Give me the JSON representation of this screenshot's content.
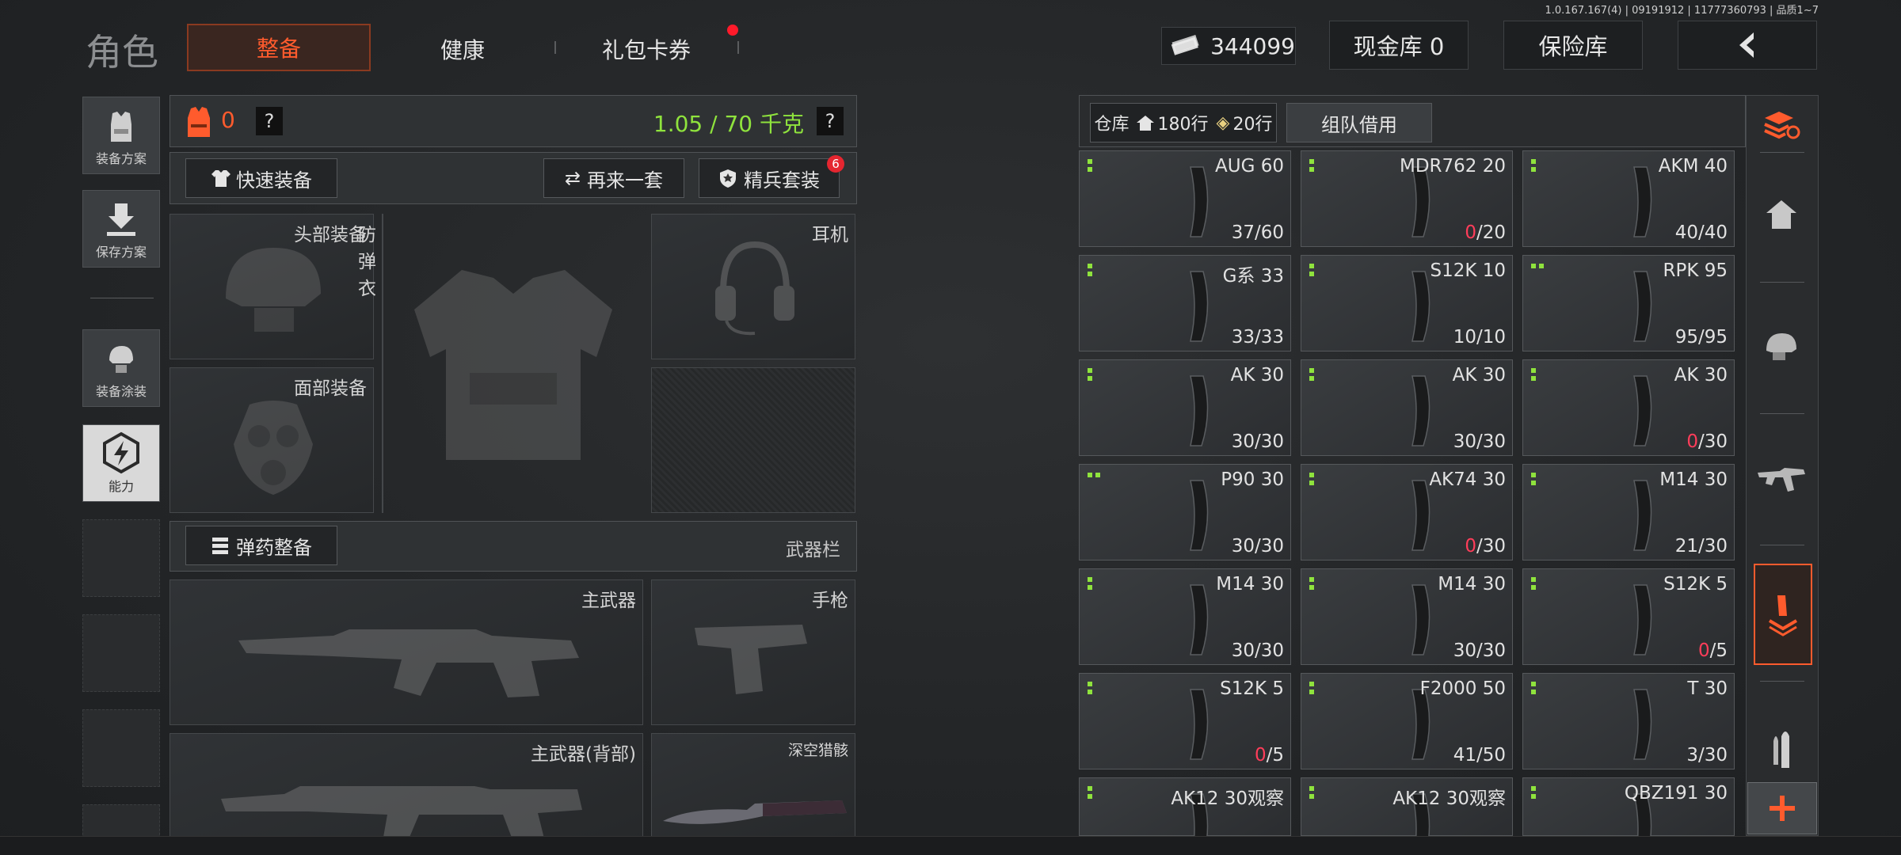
{
  "version": "1.0.167.167(4) | 09191912 | 11777360793 | 品质1~7",
  "header": {
    "title": "角色",
    "tabs": [
      {
        "label": "整备",
        "active": true
      },
      {
        "label": "健康",
        "active": false
      },
      {
        "label": "礼包卡券",
        "active": false,
        "badge_dot": true
      }
    ],
    "currency_value": "344099",
    "cash_vault": "现金库 0",
    "insurance_vault": "保险库",
    "back_icon": "chevron-left-icon"
  },
  "left_sidebar": [
    {
      "label": "装备方案",
      "icon": "vest-icon"
    },
    {
      "label": "保存方案",
      "icon": "download-icon"
    },
    {
      "label": "装备涂装",
      "icon": "helmet-paint-icon"
    },
    {
      "label": "能力",
      "icon": "ability-icon"
    }
  ],
  "loadout": {
    "armor_value": "0",
    "weight": "1.05 / 70 千克",
    "help": "?",
    "quick_equip": "快速装备",
    "another_set": "再来一套",
    "elite_set": "精兵套装",
    "elite_badge": "6",
    "slots": {
      "head": "头部装备",
      "armor": "防弹衣",
      "headset": "耳机",
      "face": "面部装备",
      "primary": "主武器",
      "pistol": "手枪",
      "primary_back": "主武器(背部)",
      "melee": "深空猎骸"
    },
    "ammo_equip": "弹药整备",
    "weapon_bar": "武器栏"
  },
  "inventory": {
    "warehouse_label": "仓库",
    "rows_home": "180行",
    "rows_extra": "20行",
    "team_borrow": "组队借用",
    "items": [
      {
        "name": "AUG 60",
        "count_cur": "37",
        "count_max": "/60",
        "empty": false
      },
      {
        "name": "MDR762 20",
        "count_cur": "0",
        "count_max": "/20",
        "empty": true
      },
      {
        "name": "AKM 40",
        "count_cur": "40",
        "count_max": "/40",
        "empty": false
      },
      {
        "name": "G系 33",
        "count_cur": "33",
        "count_max": "/33",
        "empty": false
      },
      {
        "name": "S12K 10",
        "count_cur": "10",
        "count_max": "/10",
        "empty": false
      },
      {
        "name": "RPK 95",
        "count_cur": "95",
        "count_max": "/95",
        "empty": false
      },
      {
        "name": "AK 30",
        "count_cur": "30",
        "count_max": "/30",
        "empty": false
      },
      {
        "name": "AK 30",
        "count_cur": "30",
        "count_max": "/30",
        "empty": false
      },
      {
        "name": "AK 30",
        "count_cur": "0",
        "count_max": "/30",
        "empty": true
      },
      {
        "name": "P90 30",
        "count_cur": "30",
        "count_max": "/30",
        "empty": false
      },
      {
        "name": "AK74 30",
        "count_cur": "0",
        "count_max": "/30",
        "empty": true
      },
      {
        "name": "M14 30",
        "count_cur": "21",
        "count_max": "/30",
        "empty": false
      },
      {
        "name": "M14 30",
        "count_cur": "30",
        "count_max": "/30",
        "empty": false
      },
      {
        "name": "M14 30",
        "count_cur": "30",
        "count_max": "/30",
        "empty": false
      },
      {
        "name": "S12K 5",
        "count_cur": "0",
        "count_max": "/5",
        "empty": true
      },
      {
        "name": "S12K 5",
        "count_cur": "0",
        "count_max": "/5",
        "empty": true
      },
      {
        "name": "F2000 50",
        "count_cur": "41",
        "count_max": "/50",
        "empty": false
      },
      {
        "name": "T 30",
        "count_cur": "3",
        "count_max": "/30",
        "empty": false
      },
      {
        "name": "AK12 30观察",
        "count_cur": "",
        "count_max": "",
        "empty": false
      },
      {
        "name": "AK12 30观察",
        "count_cur": "",
        "count_max": "",
        "empty": false
      },
      {
        "name": "QBZ191 30",
        "count_cur": "",
        "count_max": "",
        "empty": false
      }
    ]
  },
  "right_sidebar": [
    "sort-icon",
    "home-icon",
    "helmet-icon",
    "rifle-icon",
    "unload-icon",
    "ammo-icon",
    "plus-icon"
  ],
  "colors": {
    "accent": "#ff5b2d",
    "green": "#8fe33d",
    "red": "#ff3d5a"
  }
}
